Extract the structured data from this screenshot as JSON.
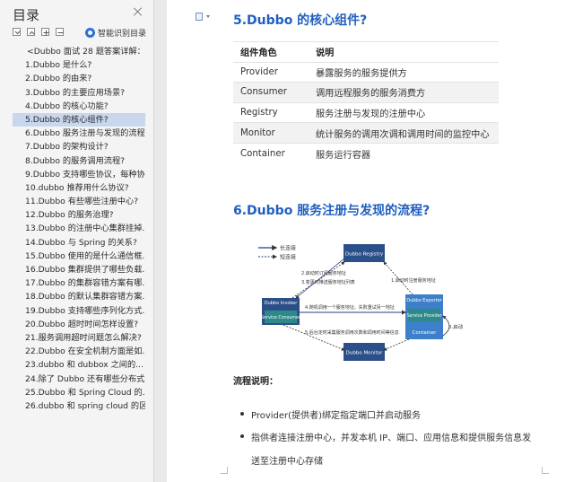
{
  "sidebar": {
    "title": "目录",
    "ai_toc_label": "智能识别目录",
    "items": [
      "<Dubbo 面试 28 题答案详解：...",
      "1.Dubbo 是什么?",
      "2.Dubbo 的由来?",
      "3.Dubbo 的主要应用场景?",
      "4.Dubbo 的核心功能?",
      "5.Dubbo 的核心组件?",
      "6.Dubbo 服务注册与发现的流程...",
      "7.Dubbo 的架构设计?",
      "8.Dubbo 的服务调用流程?",
      "9.Dubbo 支持哪些协议，每种协...",
      "10.dubbo 推荐用什么协议?",
      "11.Dubbo 有些哪些注册中心?",
      "12.Dubbo 的服务治理?",
      "13.Dubbo 的注册中心集群挂掉...",
      "14.Dubbo 与 Spring 的关系?",
      "15.Dubbo 使用的是什么通信框...",
      "16.Dubbo 集群提供了哪些负载...",
      "17.Dubbo 的集群容错方案有哪...",
      "18.Dubbo 的默认集群容错方案...",
      "19.Dubbo 支持哪些序列化方式...",
      "20.Dubbo 超时时间怎样设置?",
      "21.服务调用超时问题怎么解决?",
      "22.Dubbo 在安全机制方面是如...",
      "23.dubbo 和 dubbox 之间的...",
      "24.除了 Dubbo 还有哪些分布式...",
      "25.Dubbo 和 Spring Cloud 的...",
      "26.dubbo 和 spring cloud 的区..."
    ],
    "active_index": 5
  },
  "doc": {
    "heading1": "5.Dubbo 的核心组件?",
    "table": {
      "headers": [
        "组件角色",
        "说明"
      ],
      "rows": [
        [
          "Provider",
          "暴露服务的服务提供方"
        ],
        [
          "Consumer",
          "调用远程服务的服务消费方"
        ],
        [
          "Registry",
          "服务注册与发现的注册中心"
        ],
        [
          "Monitor",
          "统计服务的调用次调和调用时间的监控中心"
        ],
        [
          "Container",
          "服务运行容器"
        ]
      ]
    },
    "heading2": "6.Dubbo 服务注册与发现的流程?",
    "diagram": {
      "legend_long": "长连接",
      "legend_short": "短连接",
      "registry": "Dubbo Registry",
      "invoker": "Dubbo Invoker",
      "consumer": "Service Consumer",
      "exporter": "Dubbo Exporter",
      "provider": "Service Provider",
      "container": "Container",
      "monitor": "Dubbo Monitor",
      "step0": "0.启动",
      "step1": "1.启动时注册服务地址",
      "step2": "2.启动时订阅服务地址",
      "step3": "3.变更时推送服务地址列表",
      "step4": "4.随机调用一个服务地址，失败重试另一地址",
      "step5": "5.后台定时采集服务调用次数和调用时间等信息"
    },
    "flow_label": "流程说明：",
    "bullets": [
      "Provider(提供者)绑定指定端口并启动服务",
      "指供者连接注册中心，并发本机 IP、端口、应用信息和提供服务信息发"
    ],
    "bullet2_continued": "送至注册中心存储"
  },
  "colors": {
    "heading_blue": "#1f5fbf",
    "active_bg": "#c8d7ee",
    "box_dark": "#2b4f88",
    "box_green": "#2e8a8a",
    "box_blue": "#3d7fc8"
  }
}
